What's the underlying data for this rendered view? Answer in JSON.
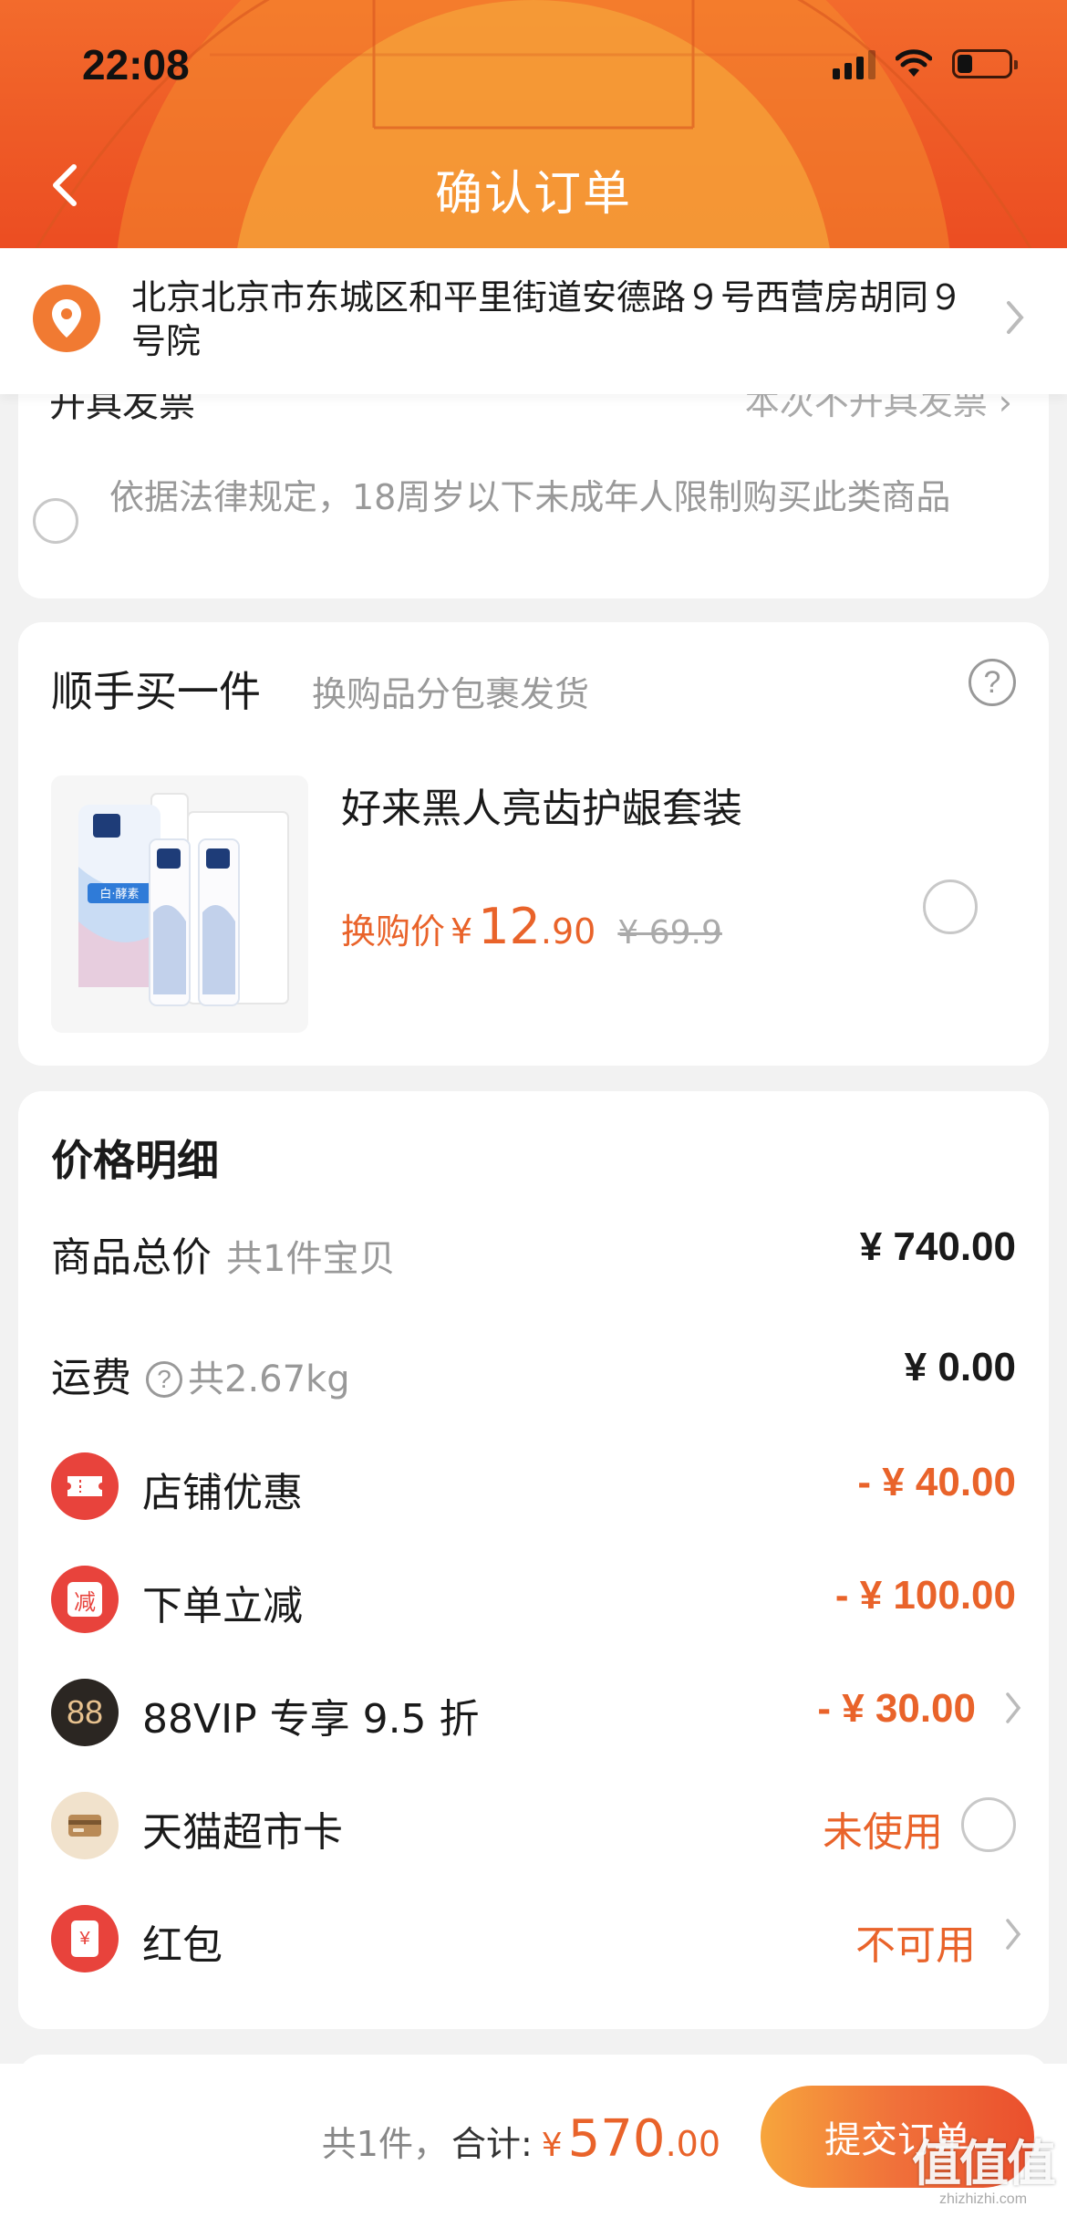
{
  "status_bar": {
    "time": "22:08"
  },
  "header": {
    "title": "确认订单"
  },
  "address": {
    "text": "北京北京市东城区和平里街道安德路９号西营房胡同９号院"
  },
  "notice_card": {
    "cut_left": "开具发票",
    "cut_right": "本次不开具发票 ›",
    "text": "依据法律规定，18周岁以下未成年人限制购买此类商品"
  },
  "addon": {
    "title": "顺手买一件",
    "subtitle": "换购品分包裹发货",
    "product_name": "好来黑人亮齿护龈套装",
    "price_label": "换购价",
    "currency": "¥",
    "price_int": "12",
    "price_dec": ".90",
    "original_price": "¥ 69.9",
    "image_label": "白·酵素"
  },
  "price_detail": {
    "title": "价格明细",
    "rows": [
      {
        "label": "商品总价",
        "sub": "共1件宝贝",
        "value": "¥ 740.00"
      },
      {
        "label": "运费",
        "sub": "共2.67kg",
        "value": "¥ 0.00"
      },
      {
        "label": "店铺优惠",
        "value": "- ¥ 40.00",
        "icon": "ticket-icon"
      },
      {
        "label": "下单立减",
        "value": "- ¥ 100.00",
        "icon": "instant-discount-icon",
        "icon_text": "减"
      },
      {
        "label": "88VIP 专享 9.5 折",
        "value": "- ¥ 30.00",
        "icon": "vip88-icon",
        "icon_text": "88"
      },
      {
        "label": "天猫超市卡",
        "value": "未使用",
        "icon": "card-icon"
      },
      {
        "label": "红包",
        "value": "不可用",
        "icon": "red-envelope-icon",
        "icon_text": "¥"
      }
    ]
  },
  "bottom": {
    "count": "共1件，",
    "total_label": "合计:",
    "currency": "¥",
    "total_int": "570",
    "total_dec": ".00",
    "submit": "提交订单"
  },
  "watermark": {
    "big": "值值值",
    "small": "zhizhizhi.com"
  },
  "colors": {
    "accent": "#e9632a",
    "header": "#ee5a26",
    "button_start": "#f7a53c",
    "button_end": "#ea4f2d"
  }
}
